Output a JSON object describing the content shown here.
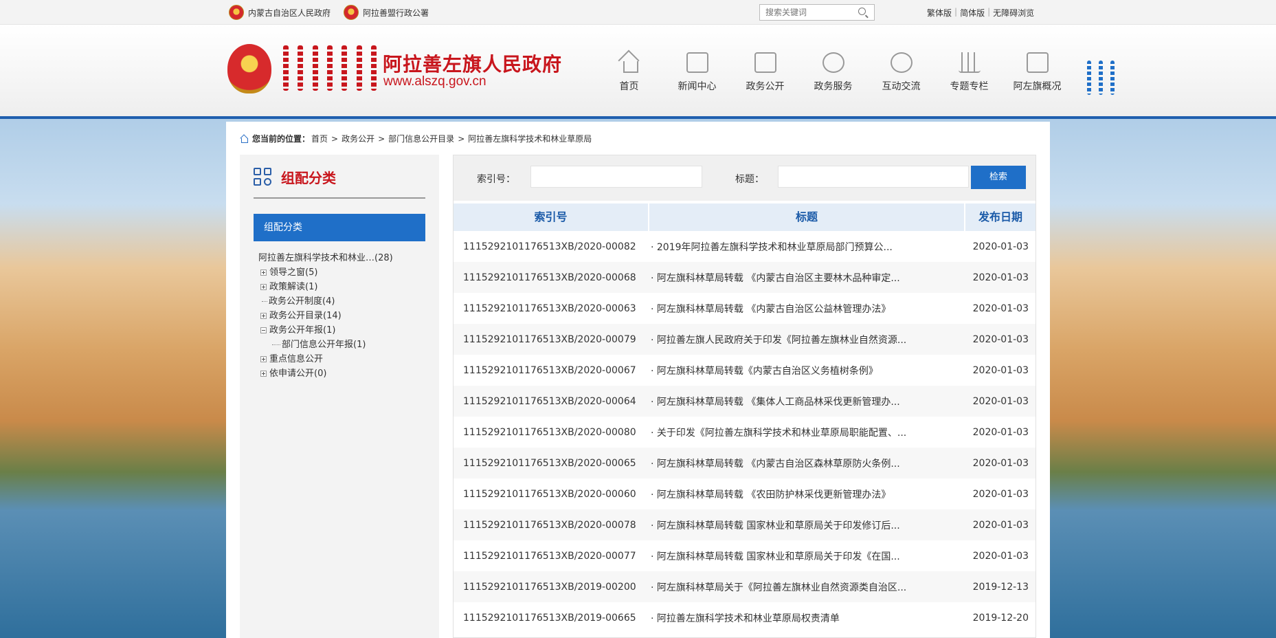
{
  "topbar": {
    "link1": "内蒙古自治区人民政府",
    "link2": "阿拉善盟行政公署",
    "search_placeholder": "搜索关键词",
    "lang1": "繁体版",
    "lang2": "简体版",
    "lang3": "无障碍浏览"
  },
  "header": {
    "title": "阿拉善左旗人民政府",
    "url": "www.alszq.gov.cn",
    "nav": [
      "首页",
      "新闻中心",
      "政务公开",
      "政务服务",
      "互动交流",
      "专题专栏",
      "阿左旗概况"
    ]
  },
  "breadcrumb": {
    "label": "您当前的位置：",
    "items": [
      "首页",
      "政务公开",
      "部门信息公开目录",
      "阿拉善左旗科学技术和林业草原局"
    ]
  },
  "sidebar": {
    "title": "组配分类",
    "button": "组配分类",
    "tree": {
      "root": "阿拉善左旗科学技术和林业…(28)",
      "nodes": [
        "领导之窗(5)",
        "政策解读(1)",
        "政务公开制度(4)",
        "政务公开目录(14)",
        "政务公开年报(1)",
        "部门信息公开年报(1)",
        "重点信息公开",
        "依申请公开(0)"
      ]
    }
  },
  "filter": {
    "index_label": "索引号：",
    "title_label": "标题：",
    "search_button": "检索"
  },
  "table": {
    "headers": [
      "索引号",
      "标题",
      "发布日期"
    ],
    "rows": [
      [
        "1115292101176513XB/2020-00082",
        "· 2019年阿拉善左旗科学技术和林业草原局部门预算公...",
        "2020-01-03"
      ],
      [
        "1115292101176513XB/2020-00068",
        "· 阿左旗科林草局转载 《内蒙古自治区主要林木品种审定...",
        "2020-01-03"
      ],
      [
        "1115292101176513XB/2020-00063",
        "· 阿左旗科林草局转载 《内蒙古自治区公益林管理办法》",
        "2020-01-03"
      ],
      [
        "1115292101176513XB/2020-00079",
        "· 阿拉善左旗人民政府关于印发《阿拉善左旗林业自然资源...",
        "2020-01-03"
      ],
      [
        "1115292101176513XB/2020-00067",
        "· 阿左旗科林草局转载《内蒙古自治区义务植树条例》",
        "2020-01-03"
      ],
      [
        "1115292101176513XB/2020-00064",
        "· 阿左旗科林草局转载 《集体人工商品林采伐更新管理办...",
        "2020-01-03"
      ],
      [
        "1115292101176513XB/2020-00080",
        "· 关于印发《阿拉善左旗科学技术和林业草原局职能配置、...",
        "2020-01-03"
      ],
      [
        "1115292101176513XB/2020-00065",
        "· 阿左旗科林草局转载 《内蒙古自治区森林草原防火条例...",
        "2020-01-03"
      ],
      [
        "1115292101176513XB/2020-00060",
        "· 阿左旗科林草局转载 《农田防护林采伐更新管理办法》",
        "2020-01-03"
      ],
      [
        "1115292101176513XB/2020-00078",
        "· 阿左旗科林草局转载 国家林业和草原局关于印发修订后...",
        "2020-01-03"
      ],
      [
        "1115292101176513XB/2020-00077",
        "· 阿左旗科林草局转载 国家林业和草原局关于印发《在国...",
        "2020-01-03"
      ],
      [
        "1115292101176513XB/2019-00200",
        "· 阿左旗科林草局关于《阿拉善左旗林业自然资源类自治区...",
        "2019-12-13"
      ],
      [
        "1115292101176513XB/2019-00665",
        "· 阿拉善左旗科学技术和林业草原局权责清单",
        "2019-12-20"
      ]
    ]
  }
}
